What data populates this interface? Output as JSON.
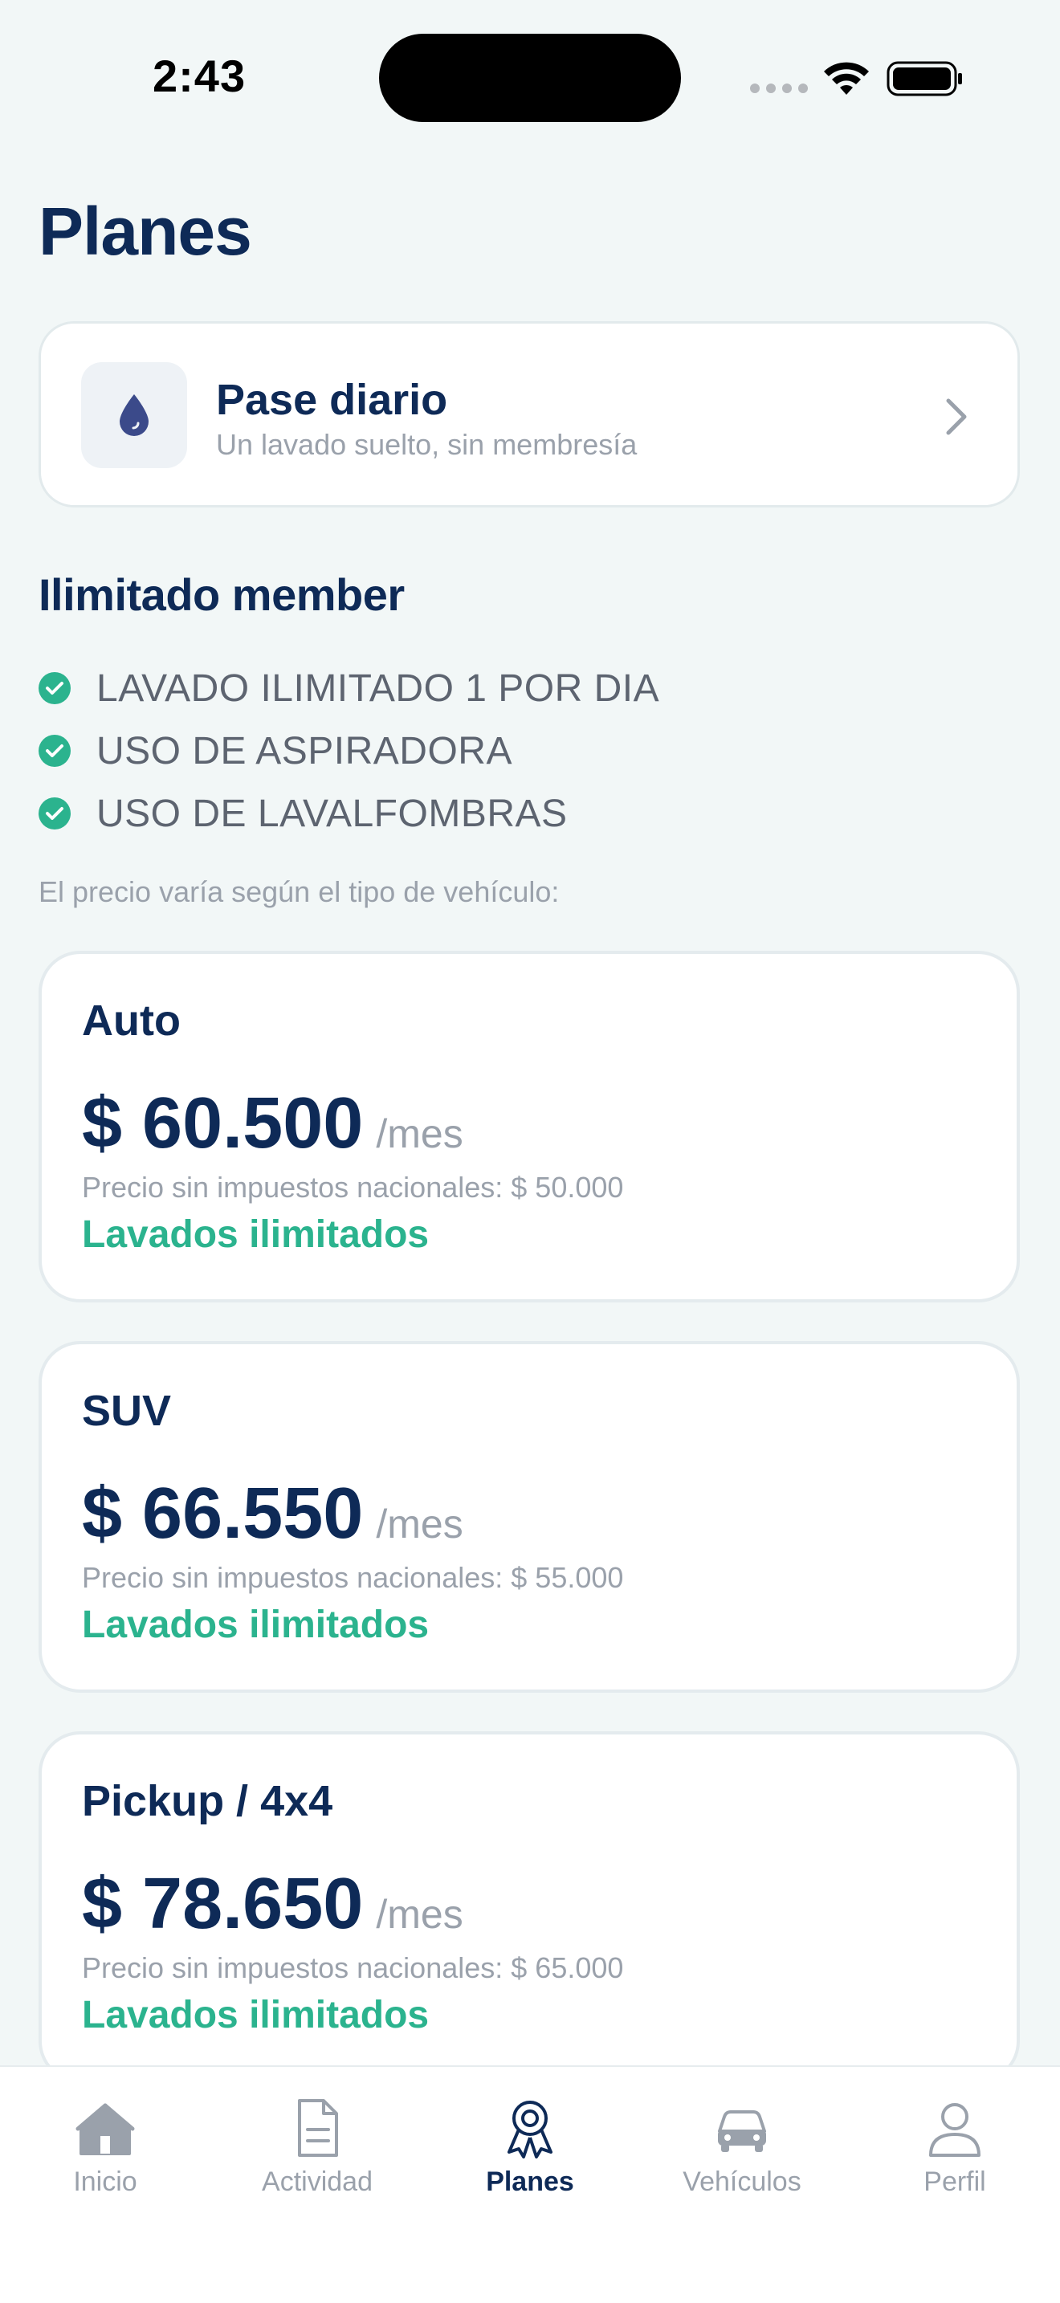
{
  "status_bar": {
    "time": "2:43"
  },
  "page": {
    "title": "Planes"
  },
  "day_pass": {
    "title": "Pase diario",
    "subtitle": "Un lavado suelto, sin membresía",
    "icon": "water-drop-icon",
    "chevron_icon": "chevron-right-icon"
  },
  "membership": {
    "title": "Ilimitado member",
    "features": [
      "LAVADO ILIMITADO 1 POR DIA",
      "USO DE ASPIRADORA",
      "USO DE LAVALFOMBRAS"
    ],
    "price_note": "El precio varía según el tipo de vehículo:"
  },
  "plans": [
    {
      "vehicle": "Auto",
      "price": "$ 60.500",
      "period": "/mes",
      "tax_note": "Precio sin impuestos nacionales: $ 50.000",
      "feature": "Lavados ilimitados"
    },
    {
      "vehicle": "SUV",
      "price": "$ 66.550",
      "period": "/mes",
      "tax_note": "Precio sin impuestos nacionales: $ 55.000",
      "feature": "Lavados ilimitados"
    },
    {
      "vehicle": "Pickup / 4x4",
      "price": "$ 78.650",
      "period": "/mes",
      "tax_note": "Precio sin impuestos nacionales: $ 65.000",
      "feature": "Lavados ilimitados"
    }
  ],
  "nav": {
    "active": "Planes",
    "items": [
      {
        "label": "Inicio",
        "icon": "home-icon"
      },
      {
        "label": "Actividad",
        "icon": "document-icon"
      },
      {
        "label": "Planes",
        "icon": "award-icon"
      },
      {
        "label": "Vehículos",
        "icon": "car-icon"
      },
      {
        "label": "Perfil",
        "icon": "user-icon"
      }
    ]
  },
  "colors": {
    "primary": "#0e2a57",
    "accent": "#2bb38e",
    "muted": "#9aa1ab",
    "background": "#f2f7f7"
  }
}
